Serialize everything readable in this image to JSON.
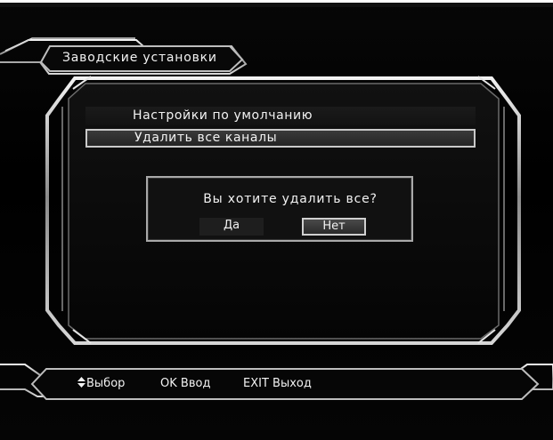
{
  "header": {
    "title": "Заводские установки"
  },
  "menu": {
    "items": [
      {
        "label": "Настройки по умолчанию",
        "selected": false
      },
      {
        "label": "Удалить все каналы",
        "selected": true
      }
    ]
  },
  "dialog": {
    "message": "Вы хотите удалить все?",
    "yes_label": "Да",
    "no_label": "Нет",
    "focused_button": "Нет"
  },
  "footer": {
    "select_icon": "up-down-arrow-icon",
    "select_label": "Выбор",
    "ok_key": "OK",
    "ok_label": "Ввод",
    "exit_key": "EXIT",
    "exit_label": "Выход"
  },
  "colors": {
    "background": "#000000",
    "frame": "#bdbdbd",
    "text": "#f2f2f2",
    "highlight_border": "#d0d0d0"
  }
}
